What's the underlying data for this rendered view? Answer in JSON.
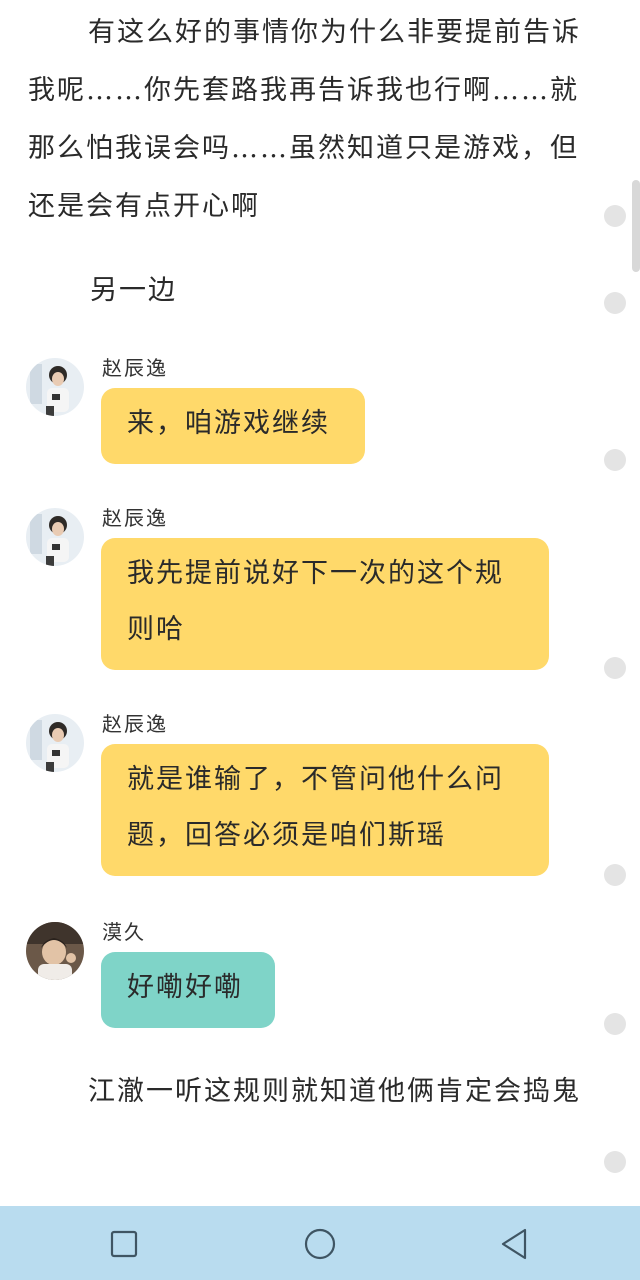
{
  "story": {
    "para1": "有这么好的事情你为什么非要提前告诉我呢……你先套路我再告诉我也行啊……就那么怕我误会吗……虽然知道只是游戏，但还是会有点开心啊",
    "para2": "另一边",
    "para3": "江澈一听这规则就知道他俩肯定会捣鬼"
  },
  "chat": {
    "messages": [
      {
        "sender": "赵辰逸",
        "text": "来，咱游戏继续",
        "color": "#ffd96a"
      },
      {
        "sender": "赵辰逸",
        "text": "我先提前说好下一次的这个规则哈",
        "color": "#ffd96a"
      },
      {
        "sender": "赵辰逸",
        "text": "就是谁输了，不管问他什么问题，回答必须是咱们斯瑶",
        "color": "#ffd96a"
      },
      {
        "sender": "漠久",
        "text": "好嘞好嘞",
        "color": "#7fd4c8"
      }
    ]
  },
  "navbar": {
    "background": "#b9dcef",
    "buttons": [
      "recent-apps-icon",
      "home-icon",
      "back-icon"
    ]
  }
}
